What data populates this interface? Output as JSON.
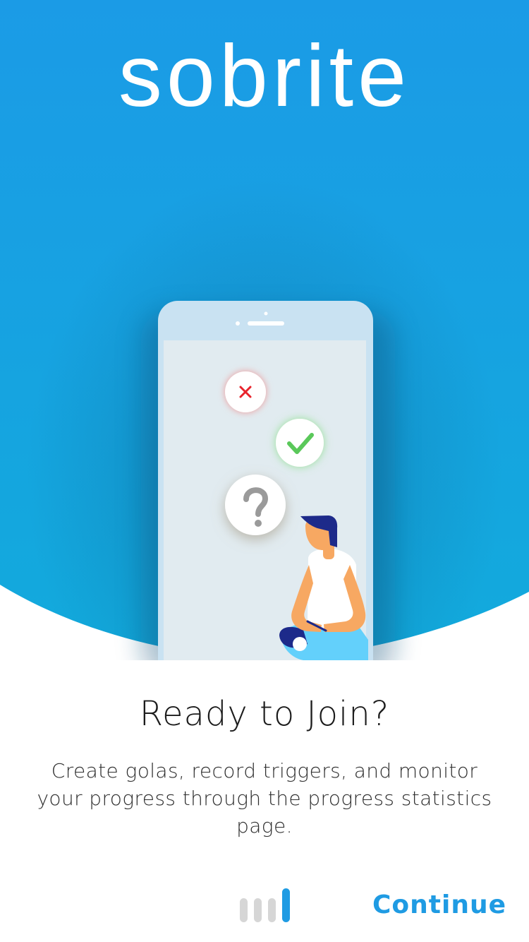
{
  "app": {
    "logo_text": "sobrite"
  },
  "onboarding": {
    "title": "Ready to Join?",
    "description": "Create golas, record triggers, and monitor your progress through the progress statistics page.",
    "continue_label": "Continue",
    "pager": {
      "total_steps": 4,
      "current_step": 4
    }
  },
  "colors": {
    "hero_gradient_top": "#1b9be6",
    "hero_gradient_bottom": "#14a9dd",
    "accent": "#1f9be3",
    "pager_inactive": "#d6d6d6",
    "pager_active": "#1f9be3",
    "error_icon": "#e8232c",
    "success_icon": "#5ac85a",
    "question_icon": "#9a9a9a"
  },
  "illustration": {
    "icons": [
      "close-icon",
      "checkmark-icon",
      "question-mark-icon"
    ]
  }
}
